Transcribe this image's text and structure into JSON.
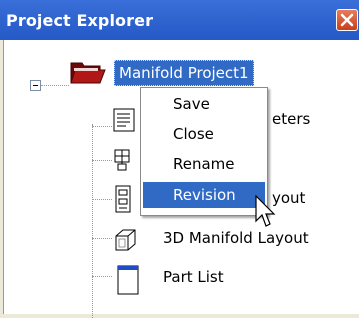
{
  "window": {
    "title": "Project Explorer"
  },
  "tree": {
    "root_label": "Manifold Project1",
    "nodes": [
      {
        "label": "eters",
        "icon": "parameters-icon"
      },
      {
        "label": "",
        "icon": "schematic-icon"
      },
      {
        "label": "yout",
        "icon": "layout-icon"
      },
      {
        "label": "3D Manifold Layout",
        "icon": "3d-cube-icon"
      },
      {
        "label": "Part List",
        "icon": "part-list-icon"
      }
    ]
  },
  "context_menu": {
    "items": [
      {
        "label": "Save"
      },
      {
        "label": "Close"
      },
      {
        "label": "Rename"
      },
      {
        "label": "Revision"
      }
    ],
    "selected": "Revision"
  },
  "colors": {
    "titlebar": "#2f64d3",
    "selection": "#316ac5",
    "folder": "#8b0f0f"
  }
}
